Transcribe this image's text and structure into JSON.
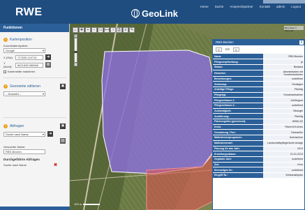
{
  "header": {
    "logo": "RWE",
    "brand": "GeoLink",
    "nav": [
      "Home",
      "Suche",
      "Ansprechpartner",
      "Kontakt",
      "admin",
      "Logout"
    ]
  },
  "sidebar": {
    "title": "Funktionen",
    "kartenposition": {
      "title": "Kartenposition",
      "coord_system_label": "Koordinatensystem:",
      "coord_system_value": "Google",
      "x_label": "X (Ost):",
      "x_value": "727835.119715",
      "y_label": "Y (Nord):",
      "y_value": "6621838.085666",
      "marker_label": "Kartenmitte markieren"
    },
    "geometrie": {
      "title": "Geometrie editieren",
      "select_value": "-- Auswahl --"
    },
    "abfragen": {
      "title": "Abfragen",
      "select_value": "Suche nach Name",
      "result_label": "Gesuchter Name:",
      "result_value": "RBS-Becken",
      "done_title": "Durchgeführte Abfragen",
      "done_item": "Suche nach Name"
    }
  },
  "map": {
    "copyright": "Bing Maps © Microsoft",
    "scale_label": "100 m",
    "toolbar_icons": [
      "home-icon",
      "pan-icon",
      "zoom-in-icon",
      "zoom-out-icon",
      "select-icon",
      "measure-icon",
      "info-icon",
      "print-icon",
      "layers-icon",
      "edit-icon"
    ],
    "colors": {
      "polygon_fill": "#8d6fe0",
      "polygon_stroke": "#ffffff",
      "highlight_fill": "#e05050"
    }
  },
  "popup": {
    "title": "RBS-Becken",
    "page_prev": "<",
    "page_text": "1/2",
    "page_next": ">",
    "rows": [
      {
        "k": "Name",
        "v": "RBS-Becken"
      },
      {
        "k": "Pflegeverpflichtung:",
        "v": "ja"
      },
      {
        "k": "Status:",
        "v": "Bestand"
      },
      {
        "k": "Hinweise:",
        "v": "Absetzbecken mit Sonderstrukturen"
      },
      {
        "k": "Bemerkungen:",
        "v": "undefined"
      },
      {
        "k": "Zielbiotop:",
        "v": "Sonstiges"
      },
      {
        "k": "Anteilige Pflege:",
        "v": "Pächtig"
      },
      {
        "k": "Pflegetyp:",
        "v": "Sonderaufnahme"
      },
      {
        "k": "Pflegezeitraum 1:",
        "v": "Juli/August"
      },
      {
        "k": "Pflegezeitraum 2:",
        "v": "undefined"
      },
      {
        "k": "Zustandigkeit:",
        "v": "Ökologie"
      },
      {
        "k": "Ausführung:",
        "v": "Pächtig"
      },
      {
        "k": "Flächengröße (gerechnet):",
        "v": "89061,52"
      },
      {
        "k": "Kreis:",
        "v": "Rhein-Erft-Kreis"
      },
      {
        "k": "Gemarkung / Flur:",
        "v": "Garsweiler"
      },
      {
        "k": "Maßnahmenprogramm:",
        "v": "Artenschutz"
      },
      {
        "k": "Maßnahmenart:",
        "v": "Landschaftspflegerische Anlage"
      },
      {
        "k": "Planung für das Jahr:",
        "v": "2013"
      },
      {
        "k": "Erstellungsdatum:",
        "v": "01.01.2013"
      },
      {
        "k": "Geplante Jahr:",
        "v": "undefined"
      },
      {
        "k": "Ziel:",
        "v": "Kern"
      },
      {
        "k": "Ehemaliges Nr.:",
        "v": "undefined"
      },
      {
        "k": "Eingriff Nr.:",
        "v": "Wirtschaftsplan"
      }
    ]
  }
}
